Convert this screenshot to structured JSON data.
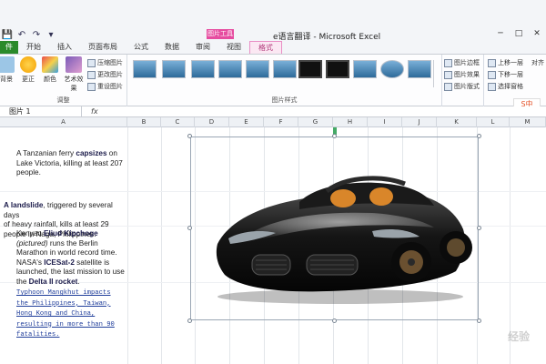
{
  "window": {
    "title": "e语言翻译 - Microsoft Excel",
    "context_group": "图片工具",
    "controls": [
      "─",
      "□",
      "✕"
    ]
  },
  "qat": {
    "save": "💾",
    "undo": "↶",
    "redo": "↷",
    "more": "▾"
  },
  "tabs": [
    {
      "label": "件"
    },
    {
      "label": "开始"
    },
    {
      "label": "插入"
    },
    {
      "label": "页面布局"
    },
    {
      "label": "公式"
    },
    {
      "label": "数据"
    },
    {
      "label": "审阅"
    },
    {
      "label": "视图"
    },
    {
      "label": "格式"
    }
  ],
  "ribbon": {
    "adjust": {
      "label": "调整",
      "btn_bg": "背景",
      "btn_correct": "更正",
      "btn_color": "颜色",
      "btn_artistic": "艺术效果",
      "compress": "压缩图片",
      "change": "更改图片",
      "reset": "重设图片"
    },
    "styles": {
      "label": "图片样式"
    },
    "picture_opts": {
      "border": "图片边框",
      "effects": "图片效果",
      "layout": "图片版式"
    },
    "arrange": {
      "bring_forward": "上移一层",
      "send_backward": "下移一层",
      "selection_pane": "选择窗格",
      "align": "对齐"
    }
  },
  "formula_bar": {
    "name_box": "图片 1",
    "fx": "fx",
    "content": ""
  },
  "columns": [
    "A",
    "B",
    "C",
    "D",
    "E",
    "F",
    "G",
    "H",
    "I",
    "J",
    "K",
    "L",
    "M"
  ],
  "cells": {
    "block1": {
      "pre": "A Tanzanian ferry ",
      "bold": "capsizes",
      "post1": " on",
      "line2": "Lake Victoria, killing at least 207",
      "line3": "people."
    },
    "block2": {
      "bold": "A landslide",
      "post": ", triggered by several days",
      "line2": "of heavy rainfall, kills at least 29",
      "line3": "people in Naga, Philippines."
    },
    "block3": {
      "pre": "Kenyan ",
      "bold": "Eliud Kipchoge",
      "italic": "(pictured)",
      "post": " runs the Berlin",
      "line3": "Marathon in world record time.",
      "line4_pre": "NASA's ",
      "line4_bold": "ICESat-2",
      "line4_post": " satellite is",
      "line5": "launched, the last mission to use",
      "line6_pre": "the ",
      "line6_bold": "Delta II rocket",
      "line6_post": "."
    },
    "block4": [
      "Typhoon Mangkhut  impacts",
      "the Philippines, Taiwan,",
      "Hong Kong and China,",
      "resulting in more than 90",
      "fatalities."
    ]
  },
  "ime": "S中",
  "watermark": "经验",
  "colors": {
    "file_tab": "#2a8a2a",
    "context_tab": "#e64ca0",
    "link": "#1f3d9a"
  }
}
